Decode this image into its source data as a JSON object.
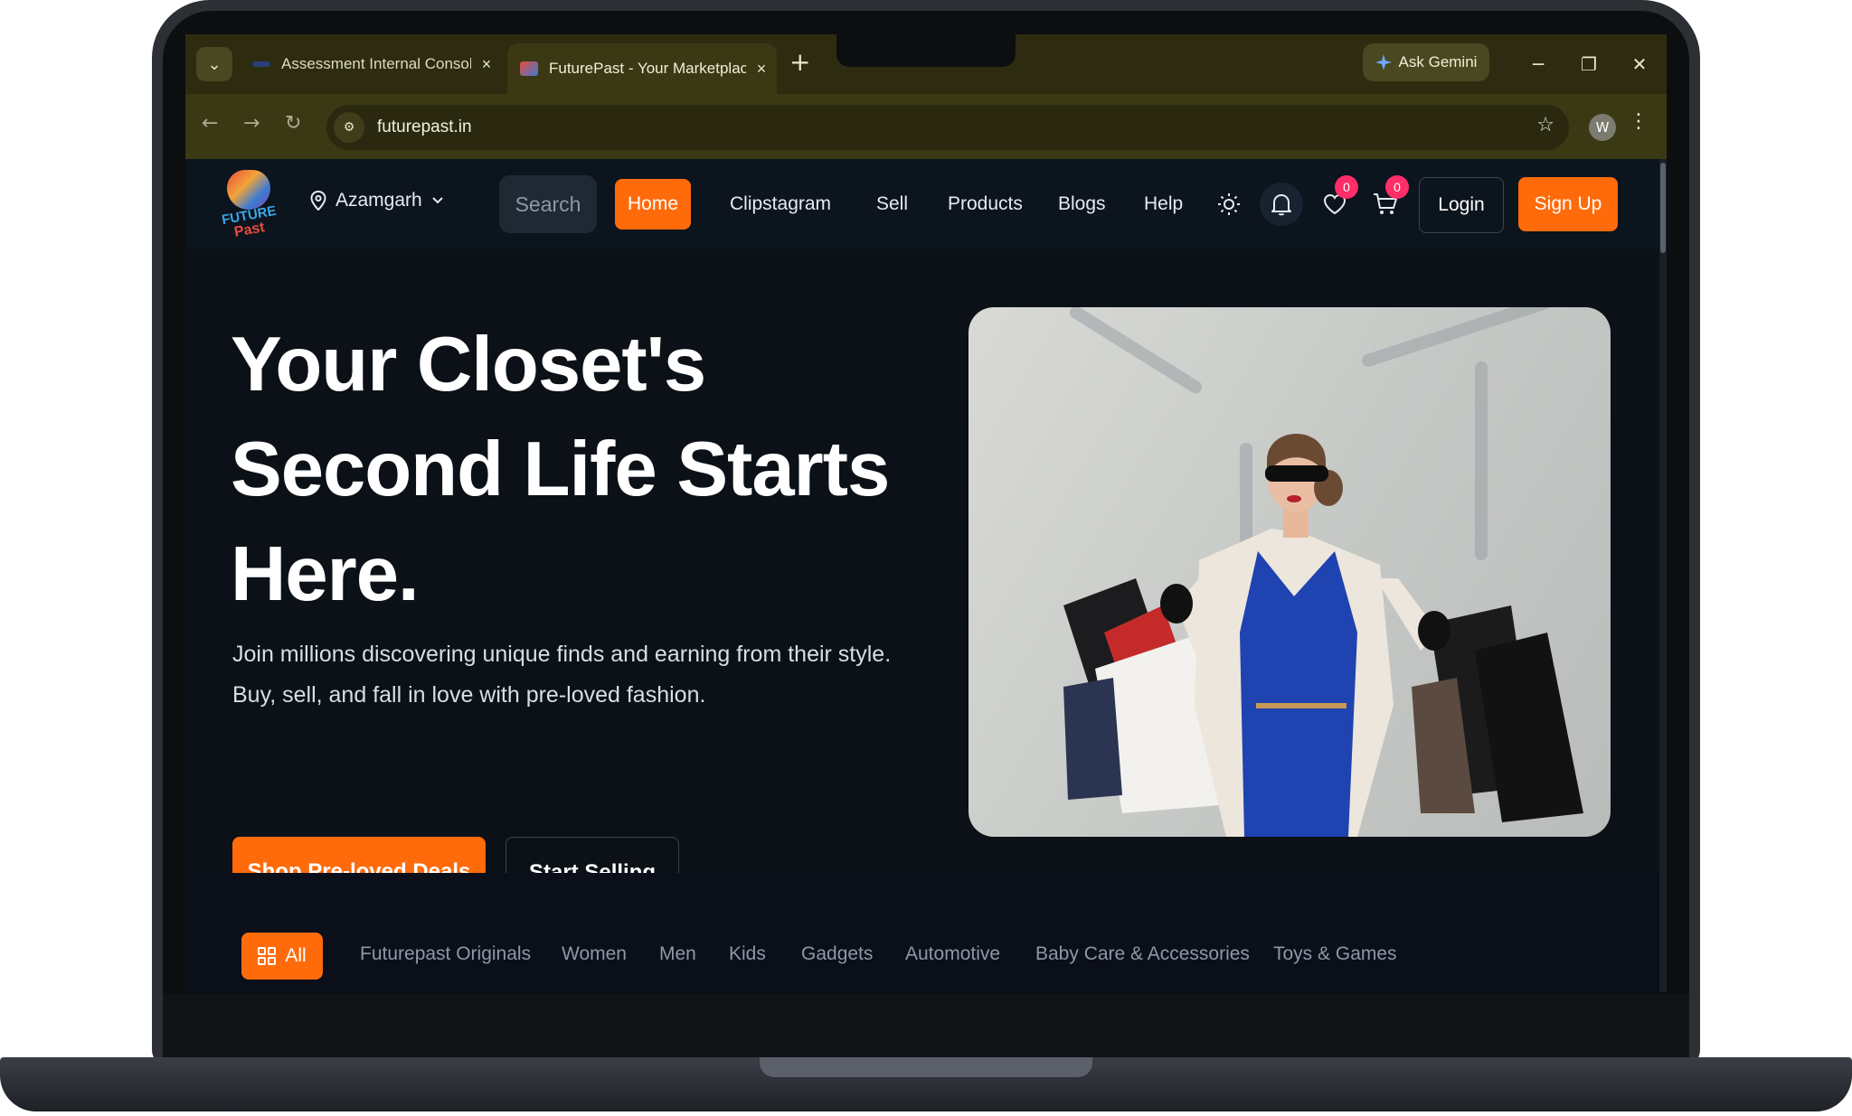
{
  "browser": {
    "tabs": [
      {
        "title": "Assessment Internal Console",
        "active": false
      },
      {
        "title": "FuturePast - Your Marketplace f",
        "active": true
      }
    ],
    "tab_close_glyph": "×",
    "new_tab_glyph": "+",
    "ask_gemini_label": "Ask Gemini",
    "url": "futurepast.in",
    "profile_initial": "W"
  },
  "site": {
    "logo": {
      "line1": "FUTURE",
      "line2": "Past"
    },
    "location": "Azamgarh",
    "search_placeholder": "Search",
    "nav": [
      "Home",
      "Clipstagram",
      "Sell",
      "Products",
      "Blogs",
      "Help"
    ],
    "active_nav": "Home",
    "wishlist_count": "0",
    "cart_count": "0",
    "login_label": "Login",
    "signup_label": "Sign Up",
    "hero": {
      "title": "Your Closet's Second Life Starts Here.",
      "subtitle": "Join millions discovering unique finds and earning from their style. Buy, sell, and fall in love with pre-loved fashion.",
      "primary_cta": "Shop Pre-loved Deals",
      "secondary_cta": "Start Selling"
    },
    "categories": [
      "All",
      "Futurepast Originals",
      "Women",
      "Men",
      "Kids",
      "Gadgets",
      "Automotive",
      "Baby Care & Accessories",
      "Toys & Games"
    ]
  },
  "colors": {
    "accent": "#ff6b0a",
    "badge": "#ff2d68",
    "page_bg": "#0b1117",
    "browser_chrome": "#2e2c10"
  },
  "icons": [
    "location-pin-icon",
    "chevron-down-icon",
    "sun-icon",
    "bell-icon",
    "heart-icon",
    "cart-icon",
    "grid-icon",
    "star-icon",
    "reload-icon",
    "back-icon",
    "forward-icon"
  ]
}
